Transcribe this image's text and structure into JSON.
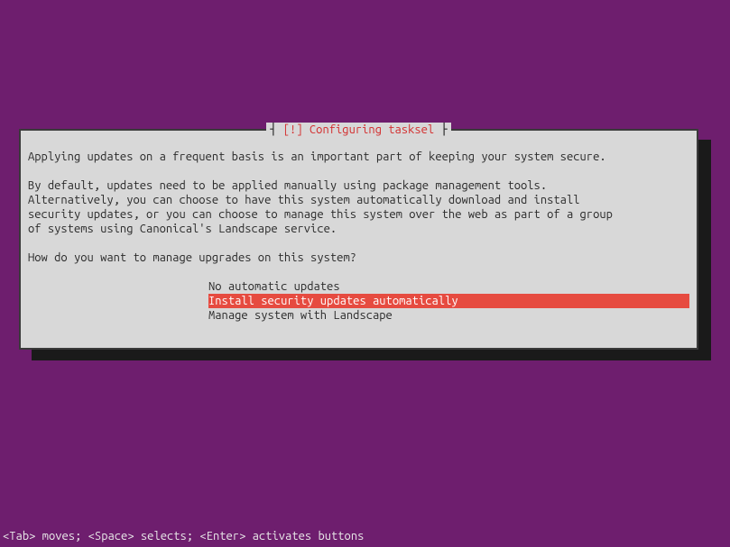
{
  "dialog": {
    "title_prefix": "┤ ",
    "title_marker": "[!]",
    "title_text": "Configuring tasksel",
    "title_suffix": " ├",
    "paragraph1": "Applying updates on a frequent basis is an important part of keeping your system secure.",
    "paragraph2": "By default, updates need to be applied manually using package management tools.\nAlternatively, you can choose to have this system automatically download and install\nsecurity updates, or you can choose to manage this system over the web as part of a group\nof systems using Canonical's Landscape service.",
    "question": "How do you want to manage upgrades on this system?",
    "options": [
      {
        "label": "No automatic updates",
        "selected": false
      },
      {
        "label": "Install security updates automatically",
        "selected": true
      },
      {
        "label": "Manage system with Landscape",
        "selected": false
      }
    ]
  },
  "statusbar": "<Tab> moves; <Space> selects; <Enter> activates buttons"
}
